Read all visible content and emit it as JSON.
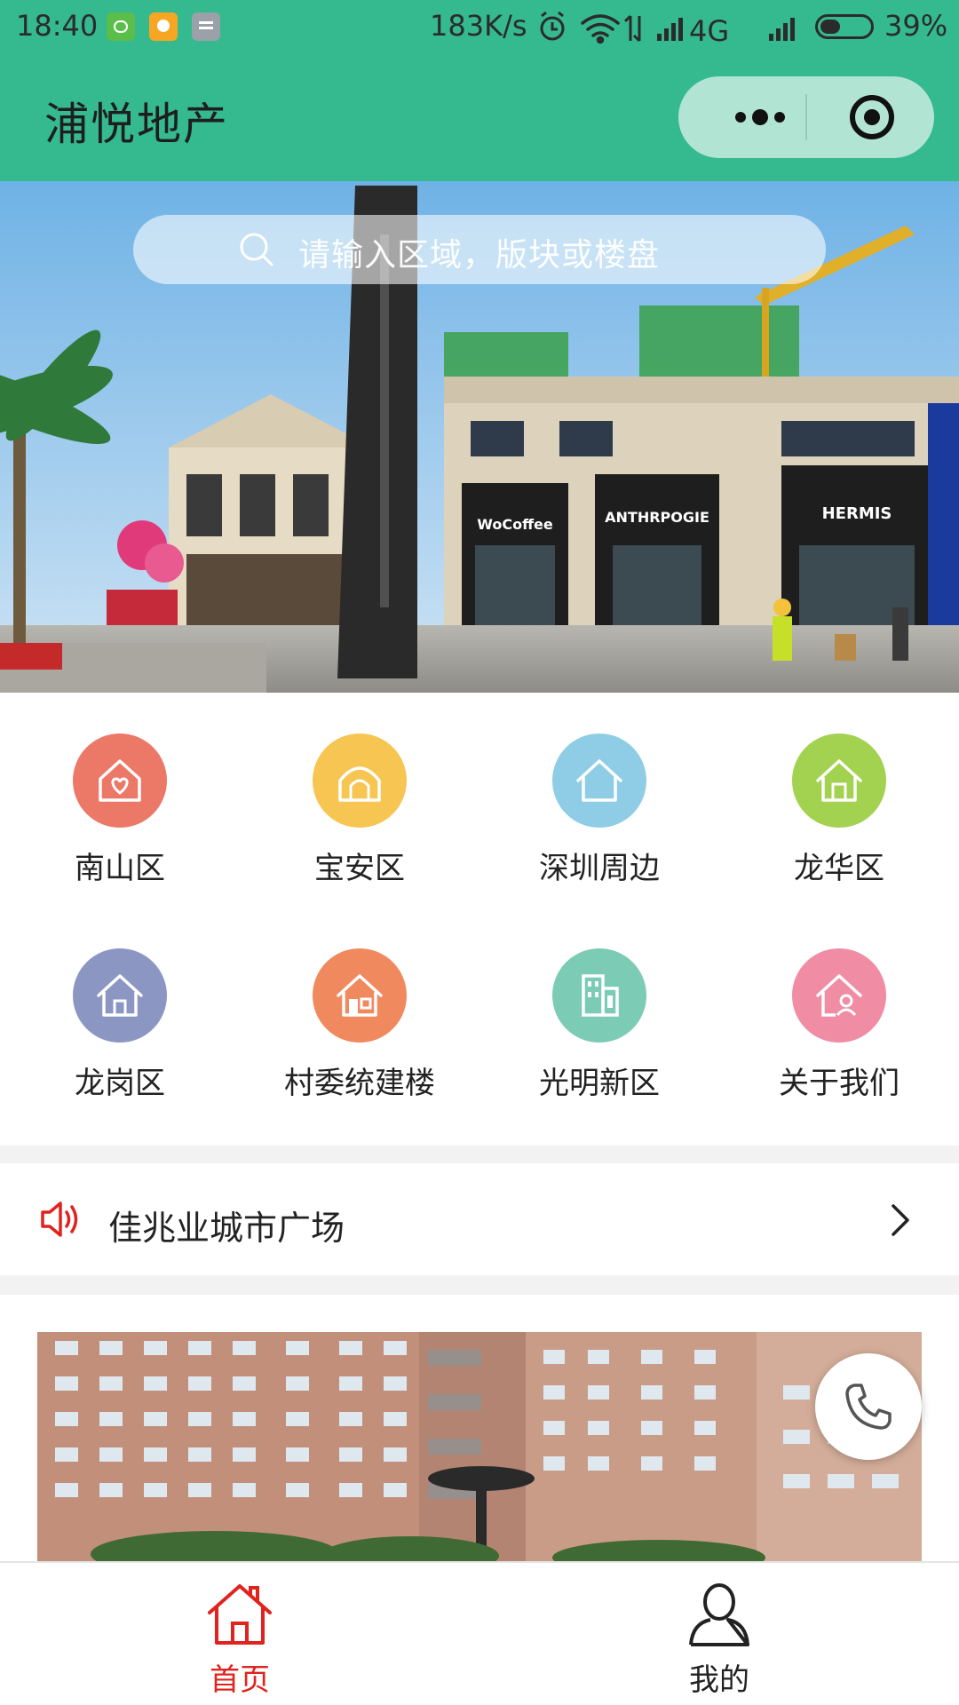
{
  "status_bar": {
    "time": "18:40",
    "network_speed": "183K/s",
    "network_type": "4G",
    "battery_percent": "39%"
  },
  "header": {
    "title": "浦悦地产",
    "capsule_icons": [
      "more-dots-icon",
      "target-icon"
    ]
  },
  "search": {
    "placeholder": "请输入区域，版块或楼盘"
  },
  "banner": {
    "store_signs": [
      "WoCoffee",
      "ANTHRPOGIE",
      "HERMIS"
    ]
  },
  "categories": [
    {
      "label": "南山区",
      "icon": "house-heart-icon",
      "color": "#ec7867"
    },
    {
      "label": "宝安区",
      "icon": "house-arch-icon",
      "color": "#f6c552"
    },
    {
      "label": "深圳周边",
      "icon": "house-outline-icon",
      "color": "#8fcde6"
    },
    {
      "label": "龙华区",
      "icon": "house-door-icon",
      "color": "#a3d150"
    },
    {
      "label": "龙岗区",
      "icon": "house-door-icon",
      "color": "#8b96c3"
    },
    {
      "label": "村委统建楼",
      "icon": "house-window-icon",
      "color": "#f0895e"
    },
    {
      "label": "光明新区",
      "icon": "building-icon",
      "color": "#7ccbb4"
    },
    {
      "label": "关于我们",
      "icon": "house-person-icon",
      "color": "#f08ca3"
    }
  ],
  "notice": {
    "text": "佳兆业城市广场"
  },
  "tabs": [
    {
      "label": "首页",
      "icon": "home-icon",
      "active": true
    },
    {
      "label": "我的",
      "icon": "user-icon",
      "active": false
    }
  ],
  "colors": {
    "brand_green": "#35b98e",
    "active_red": "#e0231e"
  }
}
